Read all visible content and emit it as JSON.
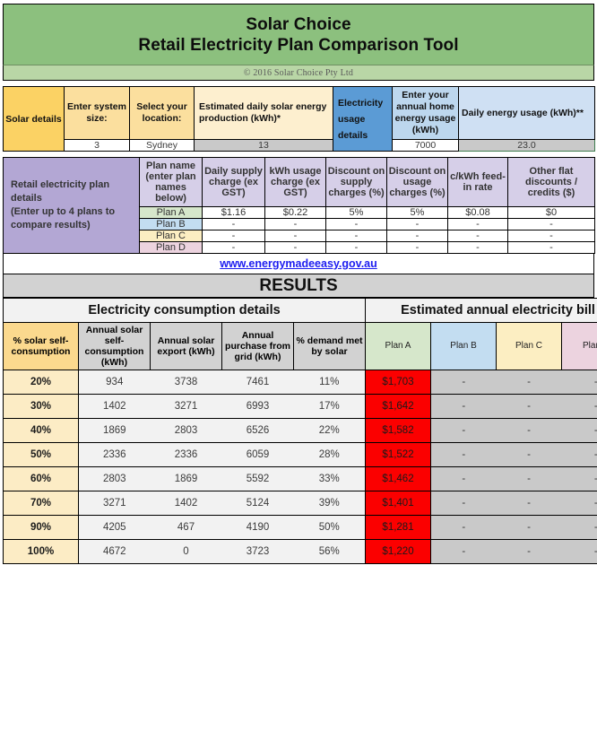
{
  "header": {
    "title_line1": "Solar Choice",
    "title_line2": "Retail Electricity Plan Comparison Tool",
    "copyright": "© 2016 Solar Choice Pty Ltd",
    "banner_color": "#8cc07e",
    "copyright_bar_color": "#b9d6a6"
  },
  "solar_details": {
    "side_heading": "Solar details",
    "side_heading_color": "#fbd264",
    "columns": [
      {
        "label": "Enter system size:",
        "value": "3"
      },
      {
        "label": "Select your location:",
        "value": "Sydney"
      },
      {
        "label": "Estimated daily solar energy production (kWh)*",
        "value": "13"
      }
    ]
  },
  "electricity_usage": {
    "side_heading": "Electricity usage details",
    "side_heading_color": "#5b9bd5",
    "columns": [
      {
        "label": "Enter your annual home energy usage (kWh)",
        "value": "7000"
      },
      {
        "label": "Daily energy usage (kWh)**",
        "value": "23.0"
      }
    ]
  },
  "retail_plans": {
    "side_heading_line1": "Retail electricity plan details",
    "side_heading_line2": "(Enter up to 4 plans to compare results)",
    "side_heading_color": "#b3a7d4",
    "headers": [
      "Plan name (enter plan names below)",
      "Daily supply charge (ex GST)",
      "kWh usage charge (ex GST)",
      "Discount on supply charges (%)",
      "Discount on usage charges (%)",
      "c/kWh feed-in rate",
      "Other flat discounts / credits ($)"
    ],
    "rows": [
      {
        "name": "Plan A",
        "color": "#d6e7cb",
        "values": [
          "$1.16",
          "$0.22",
          "5%",
          "5%",
          "$0.08",
          "$0"
        ]
      },
      {
        "name": "Plan B",
        "color": "#c3ddf1",
        "values": [
          "-",
          "-",
          "-",
          "-",
          "-",
          "-"
        ]
      },
      {
        "name": "Plan C",
        "color": "#fceec2",
        "values": [
          "-",
          "-",
          "-",
          "-",
          "-",
          "-"
        ]
      },
      {
        "name": "Plan D",
        "color": "#ecd3df",
        "values": [
          "-",
          "-",
          "-",
          "-",
          "-",
          "-"
        ]
      }
    ]
  },
  "link": {
    "text": "www.energymadeeasy.gov.au",
    "color": "#1d1df0"
  },
  "results": {
    "banner": "RESULTS",
    "group_headers": [
      "Electricity consumption details",
      "Estimated annual electricity bill"
    ],
    "consumption_headers": [
      "% solar self-consumption",
      "Annual solar self-consumption (kWh)",
      "Annual solar export (kWh)",
      "Annual purchase from grid (kWh)",
      "% demand met by solar"
    ],
    "bill_headers": [
      "Plan A",
      "Plan B",
      "Plan C",
      "Plan D"
    ],
    "bill_header_colors": [
      "#d6e7cb",
      "#c3ddf1",
      "#fceec2",
      "#ecd3df"
    ],
    "highlight_color": "#fb0000",
    "rows": [
      {
        "pct": "20%",
        "self_consumption": "934",
        "export": "3738",
        "grid": "7461",
        "demand_met": "11%",
        "bills": [
          "$1,703",
          "-",
          "-",
          "-"
        ]
      },
      {
        "pct": "30%",
        "self_consumption": "1402",
        "export": "3271",
        "grid": "6993",
        "demand_met": "17%",
        "bills": [
          "$1,642",
          "-",
          "-",
          "-"
        ]
      },
      {
        "pct": "40%",
        "self_consumption": "1869",
        "export": "2803",
        "grid": "6526",
        "demand_met": "22%",
        "bills": [
          "$1,582",
          "-",
          "-",
          "-"
        ]
      },
      {
        "pct": "50%",
        "self_consumption": "2336",
        "export": "2336",
        "grid": "6059",
        "demand_met": "28%",
        "bills": [
          "$1,522",
          "-",
          "-",
          "-"
        ]
      },
      {
        "pct": "60%",
        "self_consumption": "2803",
        "export": "1869",
        "grid": "5592",
        "demand_met": "33%",
        "bills": [
          "$1,462",
          "-",
          "-",
          "-"
        ]
      },
      {
        "pct": "70%",
        "self_consumption": "3271",
        "export": "1402",
        "grid": "5124",
        "demand_met": "39%",
        "bills": [
          "$1,401",
          "-",
          "-",
          "-"
        ]
      },
      {
        "pct": "90%",
        "self_consumption": "4205",
        "export": "467",
        "grid": "4190",
        "demand_met": "50%",
        "bills": [
          "$1,281",
          "-",
          "-",
          "-"
        ]
      },
      {
        "pct": "100%",
        "self_consumption": "4672",
        "export": "0",
        "grid": "3723",
        "demand_met": "56%",
        "bills": [
          "$1,220",
          "-",
          "-",
          "-"
        ]
      }
    ]
  }
}
